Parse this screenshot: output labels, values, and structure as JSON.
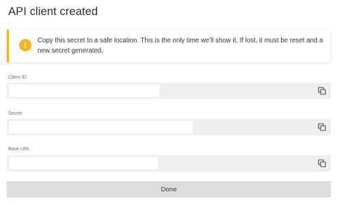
{
  "dialog": {
    "title": "API client created",
    "notice": {
      "icon": "warning-icon",
      "text": "Copy this secret to a safe location. This is the only time we'll show it. If lost, it must be reset and a new secret generated.",
      "accent_color": "#f3b51d"
    },
    "fields": [
      {
        "label": "Client ID",
        "value": "",
        "copy_icon": "copy-icon"
      },
      {
        "label": "Secret",
        "value": "",
        "copy_icon": "copy-icon"
      },
      {
        "label": "Base URL",
        "value": "",
        "copy_icon": "copy-icon"
      }
    ],
    "done_label": "Done"
  }
}
